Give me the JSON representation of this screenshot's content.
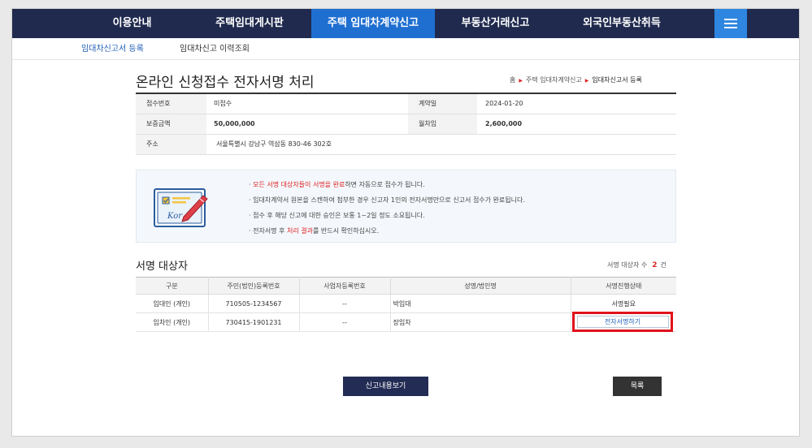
{
  "topnav": {
    "items": [
      "이용안내",
      "주택임대게시판",
      "주택 임대차계약신고",
      "부동산거래신고",
      "외국인부동산취득"
    ],
    "active_index": 2,
    "menu_icon": "hamburger-icon"
  },
  "subnav": {
    "items": [
      "임대차신고서 등록",
      "임대차신고 이력조회"
    ],
    "active_index": 0
  },
  "page": {
    "title": "온라인 신청접수 전자서명 처리",
    "breadcrumb": [
      "홈",
      "주택 임대차계약신고",
      "임대차신고서 등록"
    ]
  },
  "info": {
    "receipt_no_label": "접수번호",
    "receipt_no_value": "미접수",
    "contract_date_label": "계약일",
    "contract_date_value": "2024-01-20",
    "deposit_label": "보증금액",
    "deposit_value": "50,000,000",
    "rent_label": "월차임",
    "rent_value": "2,600,000",
    "address_label": "주소",
    "address_value": "서울특별시 강남구 역삼동 830-46 302호"
  },
  "notice": {
    "icon": "signature-document-icon",
    "icon_text": "Kor",
    "lines": [
      {
        "pre": "· ",
        "red": "모든 서명 대상자들이 서명을 완료",
        "post": "하면 자동으로 접수가 됩니다."
      },
      {
        "pre": "· 임대차계약서 원본을 스캔하여 첨부한 경우 신고자 1인의 전자서명만으로 신고서 접수가 완료됩니다.",
        "red": "",
        "post": ""
      },
      {
        "pre": "· 접수 후 해당 신고에 대한 승인은 보통 1~2일 정도 소요됩니다.",
        "red": "",
        "post": ""
      },
      {
        "pre": "· 전자서명 후 ",
        "red": "처리 결과",
        "post": "를 반드시 확인하십시오."
      }
    ]
  },
  "signers": {
    "title": "서명 대상자",
    "count_label": "서명 대상자 수",
    "count": "2",
    "count_unit": "건",
    "headers": [
      "구분",
      "주민(법인)등록번호",
      "사업자등록번호",
      "성명/법인명",
      "서명진행상태"
    ],
    "rows": [
      {
        "type": "임대인 (개인)",
        "rrn": "710505-1234567",
        "biz": "--",
        "name": "박임대",
        "status": "서명필요"
      },
      {
        "type": "임차인 (개인)",
        "rrn": "730415-1901231",
        "biz": "--",
        "name": "장임차",
        "status": "전자서명하기"
      }
    ],
    "highlight_color": "#e0121b"
  },
  "buttons": {
    "view_label": "신고내용보기",
    "list_label": "목록"
  },
  "colors": {
    "nav": "#202a4e",
    "nav_active": "#1f6fd1",
    "accent_red": "#d22",
    "link_blue": "#1f5fb8"
  }
}
